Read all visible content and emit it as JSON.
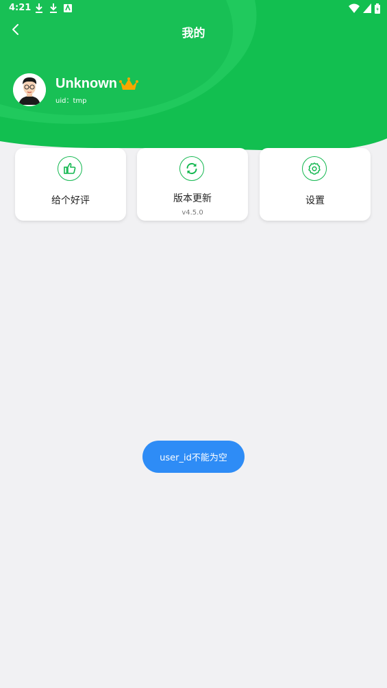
{
  "status_bar": {
    "time": "4:21",
    "left_icons": [
      "download-icon",
      "download-icon",
      "autofill-icon"
    ],
    "right_icons": [
      "wifi-icon",
      "signal-icon",
      "battery-icon"
    ]
  },
  "header": {
    "title": "我的",
    "back_icon": "chevron-left-icon"
  },
  "profile": {
    "username": "Unknown",
    "uid": "uid：tmp",
    "badge_icon": "crown-icon"
  },
  "cards": [
    {
      "label": "给个好评",
      "icon": "thumbs-up-icon"
    },
    {
      "label": "版本更新",
      "sublabel": "v4.5.0",
      "icon": "refresh-icon"
    },
    {
      "label": "设置",
      "icon": "gear-icon"
    }
  ],
  "toast": {
    "message": "user_id不能为空"
  },
  "colors": {
    "brand_green": "#12b74f",
    "header_green_light": "#1cc659",
    "toast_blue": "#2e8cf6",
    "background": "#f1f1f3",
    "crown_orange": "#f7a600"
  }
}
